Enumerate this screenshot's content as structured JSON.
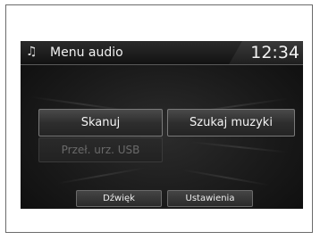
{
  "header": {
    "title": "Menu audio",
    "clock": "12:34",
    "icon": "music-note-icon"
  },
  "buttons": {
    "scan": "Skanuj",
    "search_music": "Szukaj muzyki",
    "switch_usb": "Przeł. urz. USB"
  },
  "bottom_bar": {
    "sound": "Dźwięk",
    "settings": "Ustawienia"
  }
}
